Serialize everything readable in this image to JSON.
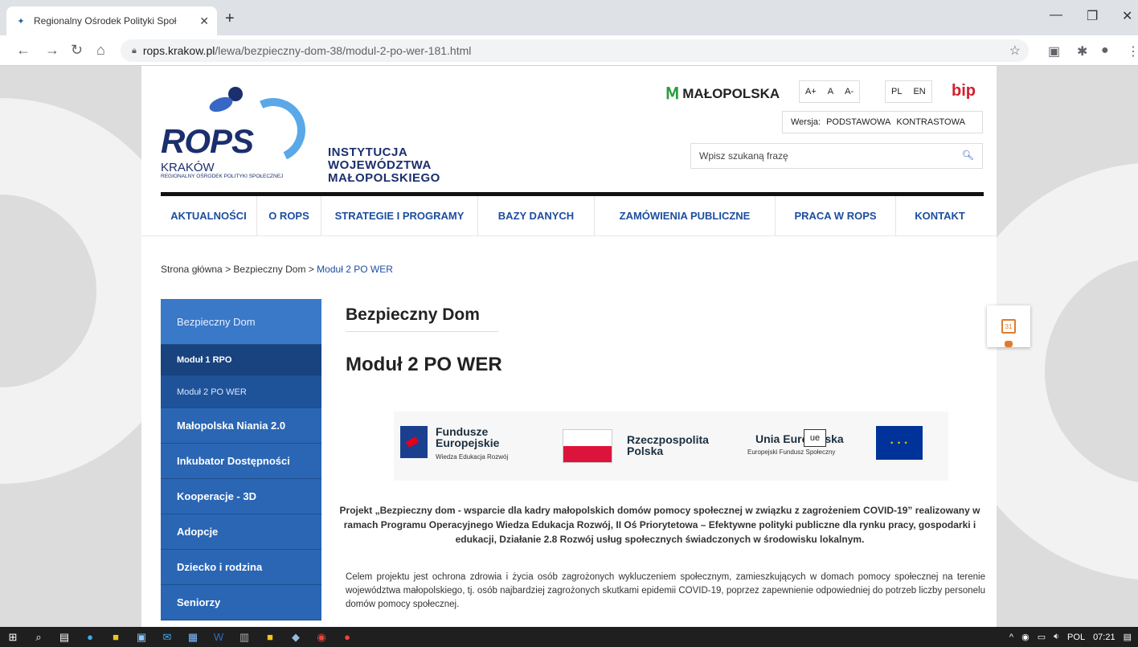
{
  "browser": {
    "tab_title": "Regionalny Ośrodek Polityki Społ",
    "new_tab": "+",
    "url_host": "rops.krakow.pl",
    "url_path": "/lewa/bezpieczny-dom-38/modul-2-po-wer-181.html"
  },
  "header": {
    "logo_name": "ROPS",
    "logo_city": "KRAKÓW",
    "logo_sub": "REGIONALNY OŚRODEK POLITYKI SPOŁECZNEJ",
    "institution": [
      "INSTYTUCJA",
      "WOJEWÓDZTWA",
      "MAŁOPOLSKIEGO"
    ],
    "malopolska": "MAŁOPOLSKA",
    "font_sizes": [
      "A+",
      "A",
      "A-"
    ],
    "languages": [
      "PL",
      "EN"
    ],
    "bip": "bip",
    "version_label": "Wersja:",
    "version_basic": "PODSTAWOWA",
    "version_contrast": "KONTRASTOWA",
    "search_placeholder": "Wpisz szukaną frazę"
  },
  "nav": [
    "AKTUALNOŚCI",
    "O ROPS",
    "STRATEGIE I PROGRAMY",
    "BAZY DANYCH",
    "ZAMÓWIENIA PUBLICZNE",
    "PRACA W ROPS",
    "KONTAKT"
  ],
  "breadcrumb": {
    "home": "Strona główna",
    "parent": "Bezpieczny Dom",
    "current": "Moduł 2 PO WER",
    "sep": ">"
  },
  "sidebar": {
    "active": "Bezpieczny Dom",
    "sub_items": [
      "Moduł 1 RPO",
      "Moduł 2 PO WER"
    ],
    "items": [
      "Małopolska Niania 2.0",
      "Inkubator Dostępności",
      "Kooperacje - 3D",
      "Adopcje",
      "Dziecko i rodzina",
      "Seniorzy"
    ]
  },
  "content": {
    "section": "Bezpieczny Dom",
    "title": "Moduł 2 PO WER",
    "logos": {
      "fe_line1": "Fundusze",
      "fe_line2": "Europejskie",
      "fe_sub": "Wiedza Edukacja Rozwój",
      "pl_line1": "Rzeczpospolita",
      "pl_line2": "Polska",
      "eu_title": "Unia Europejska",
      "eu_sub": "Europejski Fundusz Społeczny",
      "tooltip": "ue"
    },
    "bold_paragraph": "Projekt „Bezpieczny dom - wsparcie dla kadry małopolskich domów pomocy społecznej w związku z zagrożeniem COVID-19” realizowany w ramach Programu Operacyjnego Wiedza Edukacja Rozwój, II Oś Priorytetowa – Efektywne polityki publiczne dla rynku pracy, gospodarki i edukacji, Działanie 2.8 Rozwój usług społecznych świadczonych w środowisku lokalnym.",
    "body_paragraph": "Celem projektu jest ochrona zdrowia i życia osób zagrożonych wykluczeniem społecznym, zamieszkujących w domach pomocy społecznej na terenie województwa małopolskiego, tj. osób najbardziej zagrożonych skutkami epidemii COVID-19, poprzez zapewnienie odpowiedniej do potrzeb liczby personelu domów pomocy społecznej."
  },
  "widget": {
    "calendar_day": "31"
  },
  "taskbar": {
    "lang": "POL",
    "time": "07:21"
  }
}
